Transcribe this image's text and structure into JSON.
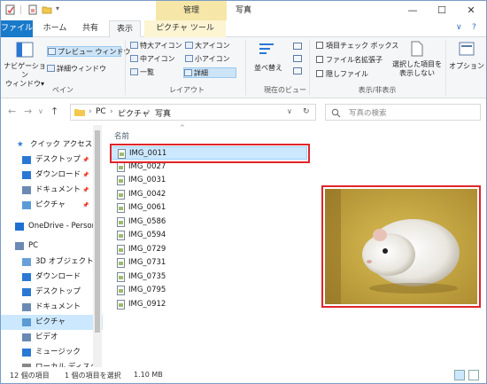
{
  "window": {
    "title": "写真",
    "context_header": "管理",
    "minimize": "—",
    "maximize": "☐",
    "close": "✕"
  },
  "tabs": [
    {
      "label": "ファイル"
    },
    {
      "label": "ホーム"
    },
    {
      "label": "共有"
    },
    {
      "label": "表示"
    },
    {
      "label": "ピクチャ ツール"
    }
  ],
  "ribbon": {
    "nav_pane": "ナビゲーション\nウィンドウ▾",
    "preview_pane": "プレビュー ウィンドウ",
    "details_pane": "詳細ウィンドウ",
    "group_pane": "ペイン",
    "layout_items": [
      "特大アイコン",
      "大アイコン",
      "中アイコン",
      "小アイコン",
      "一覧",
      "詳細"
    ],
    "group_layout": "レイアウト",
    "sort": "並べ替え",
    "group_current_view": "現在のビュー",
    "checkboxes": [
      "項目チェック ボックス",
      "ファイル名拡張子",
      "隠しファイル"
    ],
    "hide_selected": "選択した項目を\n表示しない",
    "group_show_hide": "表示/非表示",
    "options": "オプション"
  },
  "address": {
    "crumbs": [
      "PC",
      "ピクチャ",
      "写真"
    ],
    "search_placeholder": "写真の検索"
  },
  "nav_items": [
    {
      "label": "クイック アクセス",
      "pinned": false
    },
    {
      "label": "デスクトップ",
      "pinned": true
    },
    {
      "label": "ダウンロード",
      "pinned": true
    },
    {
      "label": "ドキュメント",
      "pinned": true
    },
    {
      "label": "ピクチャ",
      "pinned": true
    },
    {
      "label": "OneDrive - Person",
      "pinned": false
    },
    {
      "label": "PC",
      "pinned": false
    },
    {
      "label": "3D オブジェクト",
      "pinned": false
    },
    {
      "label": "ダウンロード",
      "pinned": false
    },
    {
      "label": "デスクトップ",
      "pinned": false
    },
    {
      "label": "ドキュメント",
      "pinned": false
    },
    {
      "label": "ピクチャ",
      "pinned": false
    },
    {
      "label": "ビデオ",
      "pinned": false
    },
    {
      "label": "ミュージック",
      "pinned": false
    },
    {
      "label": "ローカル ディスク",
      "pinned": false
    }
  ],
  "file_list": {
    "column_header": "名前",
    "files": [
      "IMG_0011",
      "IMG_0027",
      "IMG_0031",
      "IMG_0042",
      "IMG_0061",
      "IMG_0586",
      "IMG_0594",
      "IMG_0729",
      "IMG_0731",
      "IMG_0735",
      "IMG_0795",
      "IMG_0912"
    ]
  },
  "status": {
    "item_count": "12 個の項目",
    "selection": "1 個の項目を選択",
    "size": "1.10 MB"
  },
  "colors": {
    "accent": "#1979ca",
    "selection": "#cce8ff",
    "highlight_box": "#e0262a",
    "context_tab": "#f6e7a8"
  }
}
